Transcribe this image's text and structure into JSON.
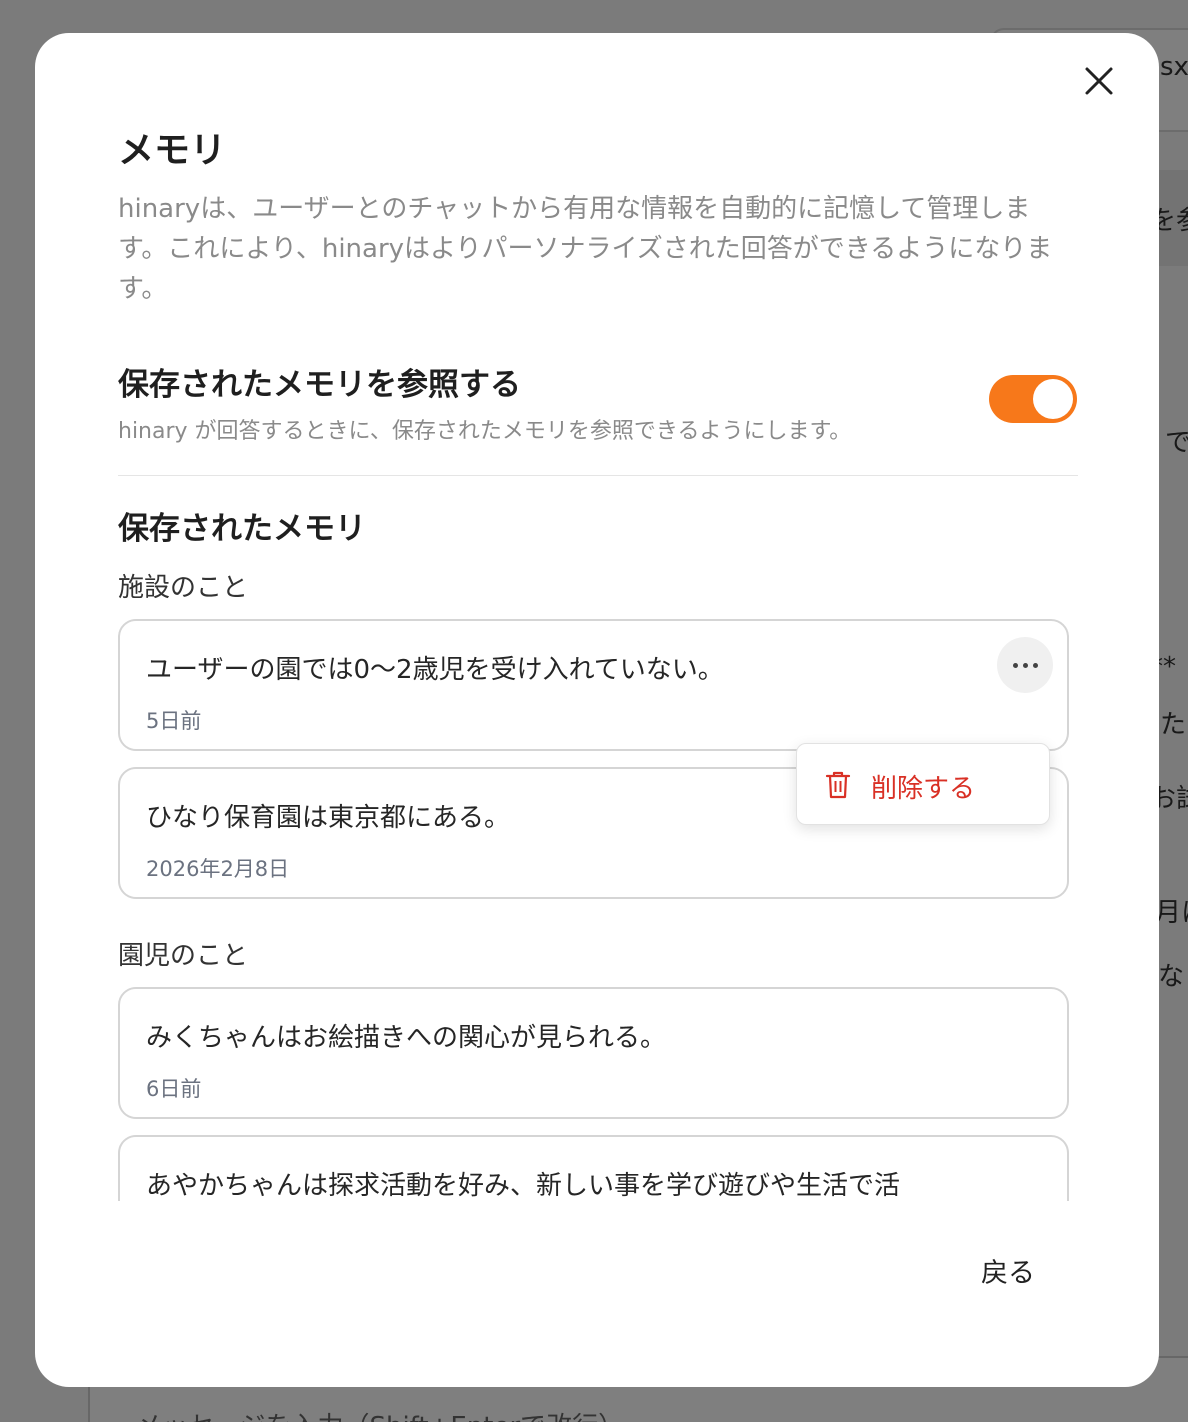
{
  "modal": {
    "title": "メモリ",
    "description": "hinaryは、ユーザーとのチャットから有用な情報を自動的に記憶して管理します。これにより、hinaryはよりパーソナライズされた回答ができるようになります。",
    "setting": {
      "title": "保存されたメモリを参照する",
      "description": "hinary が回答するときに、保存されたメモリを参照できるようにします。",
      "enabled": true
    },
    "saved_title": "保存されたメモリ",
    "categories": [
      {
        "label": "施設のこと",
        "items": [
          {
            "text": "ユーザーの園では0〜2歳児を受け入れていない。",
            "date": "5日前"
          },
          {
            "text": "ひなり保育園は東京都にある。",
            "date": "2026年2月8日"
          }
        ]
      },
      {
        "label": "園児のこと",
        "items": [
          {
            "text": "みくちゃんはお絵描きへの関心が見られる。",
            "date": "6日前"
          },
          {
            "text": "あやかちゃんは探求活動を好み、新しい事を学び遊びや生活で活",
            "date": ""
          }
        ]
      }
    ],
    "menu": {
      "delete_label": "削除する"
    },
    "back_label": "戻る"
  },
  "background": {
    "header_fragment": "sx",
    "fragments": [
      "を参",
      "で",
      "**",
      "た",
      "お試",
      "月に",
      "な"
    ],
    "input_placeholder": "メッセージを入力（Shift+Enterで改行）"
  },
  "colors": {
    "accent": "#f7781a",
    "danger": "#d93025"
  },
  "icons": {
    "close": "close-icon",
    "more": "more-horizontal-icon",
    "delete": "trash-icon"
  }
}
